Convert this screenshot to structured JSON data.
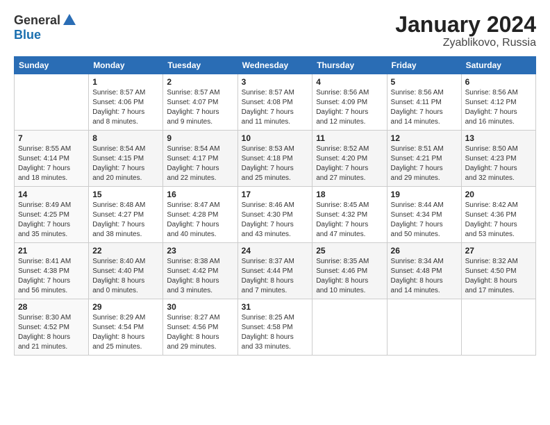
{
  "header": {
    "logo_general": "General",
    "logo_blue": "Blue",
    "title": "January 2024",
    "subtitle": "Zyablikovo, Russia"
  },
  "calendar": {
    "days_of_week": [
      "Sunday",
      "Monday",
      "Tuesday",
      "Wednesday",
      "Thursday",
      "Friday",
      "Saturday"
    ],
    "weeks": [
      [
        {
          "day": "",
          "info": ""
        },
        {
          "day": "1",
          "info": "Sunrise: 8:57 AM\nSunset: 4:06 PM\nDaylight: 7 hours\nand 8 minutes."
        },
        {
          "day": "2",
          "info": "Sunrise: 8:57 AM\nSunset: 4:07 PM\nDaylight: 7 hours\nand 9 minutes."
        },
        {
          "day": "3",
          "info": "Sunrise: 8:57 AM\nSunset: 4:08 PM\nDaylight: 7 hours\nand 11 minutes."
        },
        {
          "day": "4",
          "info": "Sunrise: 8:56 AM\nSunset: 4:09 PM\nDaylight: 7 hours\nand 12 minutes."
        },
        {
          "day": "5",
          "info": "Sunrise: 8:56 AM\nSunset: 4:11 PM\nDaylight: 7 hours\nand 14 minutes."
        },
        {
          "day": "6",
          "info": "Sunrise: 8:56 AM\nSunset: 4:12 PM\nDaylight: 7 hours\nand 16 minutes."
        }
      ],
      [
        {
          "day": "7",
          "info": "Sunrise: 8:55 AM\nSunset: 4:14 PM\nDaylight: 7 hours\nand 18 minutes."
        },
        {
          "day": "8",
          "info": "Sunrise: 8:54 AM\nSunset: 4:15 PM\nDaylight: 7 hours\nand 20 minutes."
        },
        {
          "day": "9",
          "info": "Sunrise: 8:54 AM\nSunset: 4:17 PM\nDaylight: 7 hours\nand 22 minutes."
        },
        {
          "day": "10",
          "info": "Sunrise: 8:53 AM\nSunset: 4:18 PM\nDaylight: 7 hours\nand 25 minutes."
        },
        {
          "day": "11",
          "info": "Sunrise: 8:52 AM\nSunset: 4:20 PM\nDaylight: 7 hours\nand 27 minutes."
        },
        {
          "day": "12",
          "info": "Sunrise: 8:51 AM\nSunset: 4:21 PM\nDaylight: 7 hours\nand 29 minutes."
        },
        {
          "day": "13",
          "info": "Sunrise: 8:50 AM\nSunset: 4:23 PM\nDaylight: 7 hours\nand 32 minutes."
        }
      ],
      [
        {
          "day": "14",
          "info": "Sunrise: 8:49 AM\nSunset: 4:25 PM\nDaylight: 7 hours\nand 35 minutes."
        },
        {
          "day": "15",
          "info": "Sunrise: 8:48 AM\nSunset: 4:27 PM\nDaylight: 7 hours\nand 38 minutes."
        },
        {
          "day": "16",
          "info": "Sunrise: 8:47 AM\nSunset: 4:28 PM\nDaylight: 7 hours\nand 40 minutes."
        },
        {
          "day": "17",
          "info": "Sunrise: 8:46 AM\nSunset: 4:30 PM\nDaylight: 7 hours\nand 43 minutes."
        },
        {
          "day": "18",
          "info": "Sunrise: 8:45 AM\nSunset: 4:32 PM\nDaylight: 7 hours\nand 47 minutes."
        },
        {
          "day": "19",
          "info": "Sunrise: 8:44 AM\nSunset: 4:34 PM\nDaylight: 7 hours\nand 50 minutes."
        },
        {
          "day": "20",
          "info": "Sunrise: 8:42 AM\nSunset: 4:36 PM\nDaylight: 7 hours\nand 53 minutes."
        }
      ],
      [
        {
          "day": "21",
          "info": "Sunrise: 8:41 AM\nSunset: 4:38 PM\nDaylight: 7 hours\nand 56 minutes."
        },
        {
          "day": "22",
          "info": "Sunrise: 8:40 AM\nSunset: 4:40 PM\nDaylight: 8 hours\nand 0 minutes."
        },
        {
          "day": "23",
          "info": "Sunrise: 8:38 AM\nSunset: 4:42 PM\nDaylight: 8 hours\nand 3 minutes."
        },
        {
          "day": "24",
          "info": "Sunrise: 8:37 AM\nSunset: 4:44 PM\nDaylight: 8 hours\nand 7 minutes."
        },
        {
          "day": "25",
          "info": "Sunrise: 8:35 AM\nSunset: 4:46 PM\nDaylight: 8 hours\nand 10 minutes."
        },
        {
          "day": "26",
          "info": "Sunrise: 8:34 AM\nSunset: 4:48 PM\nDaylight: 8 hours\nand 14 minutes."
        },
        {
          "day": "27",
          "info": "Sunrise: 8:32 AM\nSunset: 4:50 PM\nDaylight: 8 hours\nand 17 minutes."
        }
      ],
      [
        {
          "day": "28",
          "info": "Sunrise: 8:30 AM\nSunset: 4:52 PM\nDaylight: 8 hours\nand 21 minutes."
        },
        {
          "day": "29",
          "info": "Sunrise: 8:29 AM\nSunset: 4:54 PM\nDaylight: 8 hours\nand 25 minutes."
        },
        {
          "day": "30",
          "info": "Sunrise: 8:27 AM\nSunset: 4:56 PM\nDaylight: 8 hours\nand 29 minutes."
        },
        {
          "day": "31",
          "info": "Sunrise: 8:25 AM\nSunset: 4:58 PM\nDaylight: 8 hours\nand 33 minutes."
        },
        {
          "day": "",
          "info": ""
        },
        {
          "day": "",
          "info": ""
        },
        {
          "day": "",
          "info": ""
        }
      ]
    ]
  }
}
